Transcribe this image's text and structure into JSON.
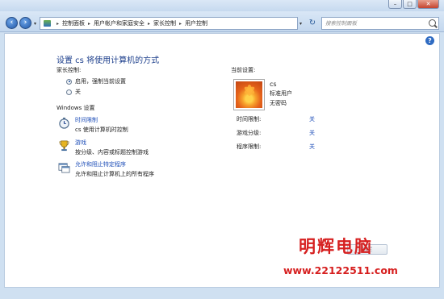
{
  "window": {
    "minimize_label": "–",
    "maximize_label": "□",
    "close_label": "✕"
  },
  "navbar": {
    "back_icon": "back-arrow-icon",
    "forward_icon": "forward-arrow-icon",
    "breadcrumb": [
      "控制面板",
      "用户帐户和家庭安全",
      "家长控制",
      "用户控制"
    ],
    "search_placeholder": "搜索控制面板"
  },
  "main": {
    "title": "设置 cs 将使用计算机的方式",
    "parental_label": "家长控制:",
    "options": [
      {
        "label": "启用，强制当前设置",
        "selected": true
      },
      {
        "label": "关",
        "selected": false
      }
    ],
    "windows_settings_label": "Windows 设置",
    "settings": [
      {
        "icon": "stopwatch-icon",
        "link": "时间限制",
        "description": "cs 使用计算机时控制"
      },
      {
        "icon": "trophy-icon",
        "link": "游戏",
        "description": "按分级、内容或标题控制游戏"
      },
      {
        "icon": "program-window-icon",
        "link": "允许和阻止特定程序",
        "description": "允许和阻止计算机上的所有程序"
      }
    ]
  },
  "current": {
    "label": "当前设置:",
    "user_name": "cs",
    "user_type": "标准用户",
    "password_status": "无密码",
    "limits": [
      {
        "label": "时间限制:",
        "value": "关"
      },
      {
        "label": "游戏分级:",
        "value": "关"
      },
      {
        "label": "程序限制:",
        "value": "关"
      }
    ]
  },
  "footer": {
    "ok_label": "确定"
  },
  "watermark": {
    "brand": "明辉电脑",
    "url": "www.22122511.com"
  }
}
